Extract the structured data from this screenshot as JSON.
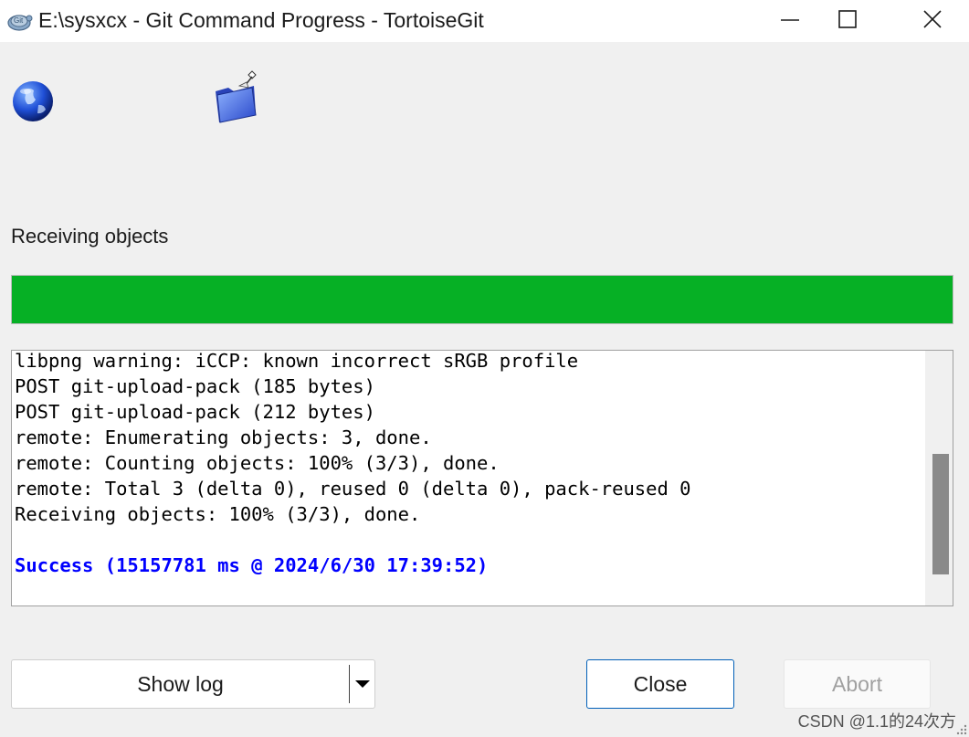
{
  "window": {
    "title": "E:\\sysxcx - Git Command Progress - TortoiseGit",
    "app_icon": "tortoisegit-icon",
    "controls": [
      "minimize-icon",
      "maximize-icon",
      "close-icon"
    ]
  },
  "header_icons": [
    "globe-icon",
    "folder-icon"
  ],
  "status": {
    "label": "Receiving objects",
    "progress_percent": 100,
    "progress_color": "#06b025"
  },
  "log": {
    "lines": [
      {
        "text": "libpng warning: iCCP: known incorrect sRGB profile",
        "color": "#000000",
        "bold": false
      },
      {
        "text": "POST git-upload-pack (185 bytes)",
        "color": "#000000",
        "bold": false
      },
      {
        "text": "POST git-upload-pack (212 bytes)",
        "color": "#000000",
        "bold": false
      },
      {
        "text": "remote: Enumerating objects: 3, done.",
        "color": "#000000",
        "bold": false
      },
      {
        "text": "remote: Counting objects: 100% (3/3), done.",
        "color": "#000000",
        "bold": false
      },
      {
        "text": "remote: Total 3 (delta 0), reused 0 (delta 0), pack-reused 0",
        "color": "#000000",
        "bold": false
      },
      {
        "text": "Receiving objects: 100% (3/3), done.",
        "color": "#000000",
        "bold": false
      },
      {
        "text": "",
        "color": "#000000",
        "bold": false
      },
      {
        "text": "Success (15157781 ms @ 2024/6/30 17:39:52)",
        "color": "#0000ff",
        "bold": true
      }
    ]
  },
  "buttons": {
    "show_log": "Show log",
    "close": "Close",
    "abort": "Abort"
  },
  "watermark": "CSDN @1.1的24次方"
}
